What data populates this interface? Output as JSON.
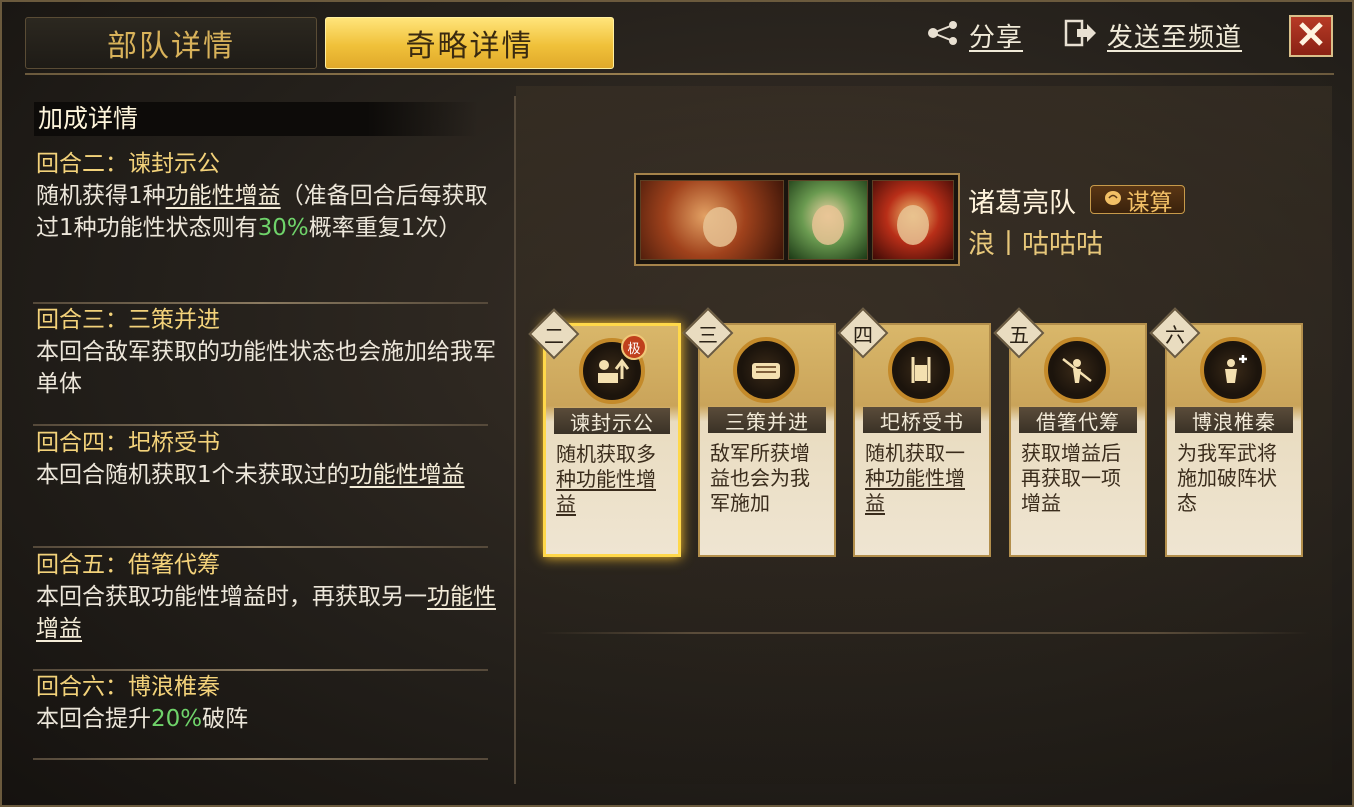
{
  "tabs": [
    {
      "label": "部队详情"
    },
    {
      "label": "奇略详情"
    }
  ],
  "topbar": {
    "share_label": "分享",
    "send_label": "发送至频道"
  },
  "left": {
    "title": "加成详情",
    "rounds": [
      {
        "title": "回合二：谏封示公",
        "body_a": "随机获得1种",
        "body_u": "功能性增益",
        "body_b": "（准备回合后每获取过1种功能性状态则有",
        "body_g": "30%",
        "body_c": "概率重复1次）"
      },
      {
        "title": "回合三：三策并进",
        "body": "本回合敌军获取的功能性状态也会施加给我军单体"
      },
      {
        "title": "回合四：圯桥受书",
        "body_a": "本回合随机获取1个未获取过的",
        "body_u": "功能性增益"
      },
      {
        "title": "回合五：借箸代筹",
        "body_a": "本回合获取功能性增益时，再获取另一",
        "body_u": "功能性增益"
      },
      {
        "title": "回合六：博浪椎秦",
        "body_a": "本回合提升",
        "body_g": "20%",
        "body_b": "破阵"
      }
    ]
  },
  "team": {
    "name": "诸葛亮队",
    "badge": "谋算",
    "player": "浪丨咕咕咕"
  },
  "cards": [
    {
      "num": "二",
      "title": "谏封示公",
      "desc_a": "随机获取多",
      "desc_u": "种功能性增益",
      "icon": "buff-up-icon",
      "badge": "极"
    },
    {
      "num": "三",
      "title": "三策并进",
      "desc": "敌军所获增益也会为我军施加",
      "icon": "scroll-icon"
    },
    {
      "num": "四",
      "title": "圯桥受书",
      "desc_a": "随机获取一",
      "desc_u": "种功能性增益",
      "icon": "sword-shield-icon"
    },
    {
      "num": "五",
      "title": "借箸代筹",
      "desc": "获取增益后再获取一项增益",
      "icon": "spear-warrior-icon"
    },
    {
      "num": "六",
      "title": "博浪椎秦",
      "desc": "为我军武将施加破阵状态",
      "icon": "warrior-plus-icon"
    }
  ],
  "colors": {
    "accent": "#f0c13a",
    "highlight_green": "#6fd36a",
    "gold_text": "#f3d27a"
  }
}
